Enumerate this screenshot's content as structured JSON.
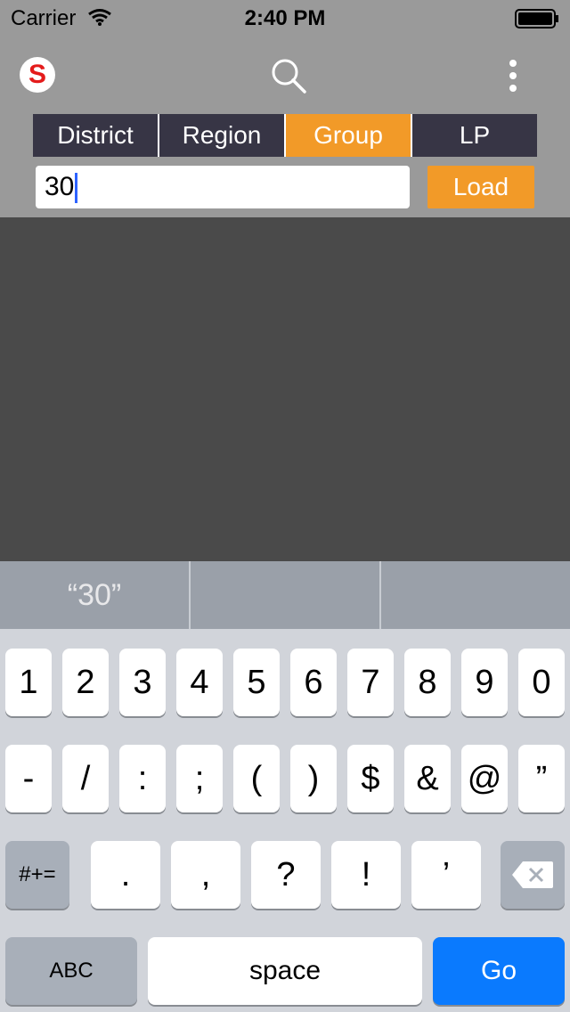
{
  "status_bar": {
    "carrier": "Carrier",
    "time": "2:40 PM"
  },
  "toolbar": {
    "logo_symbol": "S",
    "search_icon": "search-icon",
    "more_icon": "more-vertical-icon"
  },
  "segments": [
    {
      "label": "District",
      "active": false
    },
    {
      "label": "Region",
      "active": false
    },
    {
      "label": "Group",
      "active": true
    },
    {
      "label": "LP",
      "active": false
    }
  ],
  "search_field": {
    "value": "30"
  },
  "load_button": {
    "label": "Load"
  },
  "keyboard": {
    "suggestions": [
      "“30”",
      "",
      ""
    ],
    "row1": [
      "1",
      "2",
      "3",
      "4",
      "5",
      "6",
      "7",
      "8",
      "9",
      "0"
    ],
    "row2": [
      "-",
      "/",
      ":",
      ";",
      "(",
      ")",
      "$",
      "&",
      "@",
      "”"
    ],
    "row3": {
      "symbols_key": "#+=",
      "keys": [
        ".",
        ",",
        "?",
        "!",
        "’"
      ],
      "delete_icon": "backspace-icon"
    },
    "row4": {
      "abc": "ABC",
      "space": "space",
      "go": "Go"
    }
  },
  "colors": {
    "accent": "#f29a28",
    "segment_bg": "#373545",
    "go_button": "#0a7afe"
  }
}
